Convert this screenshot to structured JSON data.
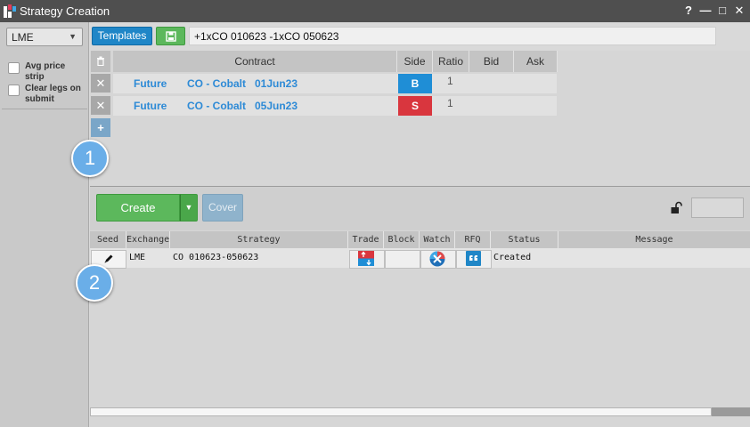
{
  "window": {
    "title": "Strategy Creation",
    "help_label": "?",
    "minimize_label": "—",
    "maximize_label": "□",
    "close_label": "✕"
  },
  "sidebar": {
    "exchange": "LME",
    "options": [
      {
        "label": "Avg price strip",
        "checked": false
      },
      {
        "label": "Clear legs on submit",
        "checked": false
      }
    ]
  },
  "toolbar": {
    "templates_label": "Templates",
    "strategy_expression": "+1xCO 010623 -1xCO 050623"
  },
  "legs": {
    "columns": [
      "Contract",
      "Side",
      "Ratio",
      "Bid",
      "Ask"
    ],
    "rows": [
      {
        "type": "Future",
        "contract": "CO - Cobalt",
        "date": "01Jun23",
        "side": "B",
        "ratio": "1"
      },
      {
        "type": "Future",
        "contract": "CO - Cobalt",
        "date": "05Jun23",
        "side": "S",
        "ratio": "1"
      }
    ],
    "add_label": "+",
    "remove_label": "✕"
  },
  "steps": {
    "first": "1",
    "second": "2"
  },
  "actions": {
    "create_label": "Create",
    "cover_label": "Cover"
  },
  "orders": {
    "columns": [
      "Seed",
      "Exchange",
      "Strategy",
      "Trade",
      "Block",
      "Watch",
      "RFQ",
      "Status",
      "Message"
    ],
    "rows": [
      {
        "exchange": "LME",
        "strategy": "CO 010623-050623",
        "status": "Created",
        "message": ""
      }
    ]
  },
  "colors": {
    "buy": "#1f8ed6",
    "sell": "#d9363e",
    "accent": "#1f86c7",
    "create": "#5cb85c"
  }
}
